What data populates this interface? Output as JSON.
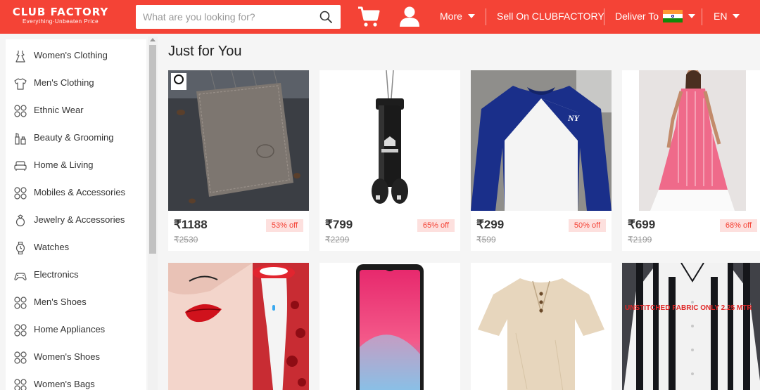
{
  "header": {
    "logo_title": "CLUB FACTORY",
    "logo_tagline": "Everything·Unbeaten Price",
    "search_placeholder": "What are you looking for?",
    "more_label": "More",
    "sell_label": "Sell On CLUBFACTORY",
    "deliver_label": "Deliver To",
    "language_label": "EN",
    "icons": [
      "search-icon",
      "cart-icon",
      "user-icon",
      "india-flag-icon"
    ],
    "brand_color": "#f44336"
  },
  "sidebar": {
    "items": [
      {
        "label": "Women's Clothing",
        "icon": "dress-icon"
      },
      {
        "label": "Men's Clothing",
        "icon": "shirt-icon"
      },
      {
        "label": "Ethnic Wear",
        "icon": "grid-circles-icon"
      },
      {
        "label": "Beauty & Grooming",
        "icon": "cosmetics-icon"
      },
      {
        "label": "Home & Living",
        "icon": "sofa-icon"
      },
      {
        "label": "Mobiles & Accessories",
        "icon": "grid-circles-icon"
      },
      {
        "label": "Jewelry & Accessories",
        "icon": "ring-icon"
      },
      {
        "label": "Watches",
        "icon": "watch-icon"
      },
      {
        "label": "Electronics",
        "icon": "gamepad-icon"
      },
      {
        "label": "Men's Shoes",
        "icon": "grid-circles-icon"
      },
      {
        "label": "Home Appliances",
        "icon": "grid-circles-icon"
      },
      {
        "label": "Women's Shoes",
        "icon": "grid-circles-icon"
      },
      {
        "label": "Women's Bags",
        "icon": "grid-circles-icon"
      }
    ]
  },
  "main": {
    "section_title": "Just for You",
    "products": [
      {
        "price": "₹1188",
        "original": "₹2530",
        "discount": "53% off",
        "image": "leather-wallet"
      },
      {
        "price": "₹799",
        "original": "₹2299",
        "discount": "65% off",
        "image": "punching-bag"
      },
      {
        "price": "₹299",
        "original": "₹599",
        "discount": "50% off",
        "image": "sweatshirt"
      },
      {
        "price": "₹699",
        "original": "₹2199",
        "discount": "68% off",
        "image": "pink-kurta"
      },
      {
        "image": "lip-plumper"
      },
      {
        "image": "smartphone"
      },
      {
        "image": "linen-shirt"
      },
      {
        "image": "striped-shirt",
        "overlay_text": "UNSTITCHED FABRIC ONLY 2.25 MTR"
      }
    ]
  }
}
